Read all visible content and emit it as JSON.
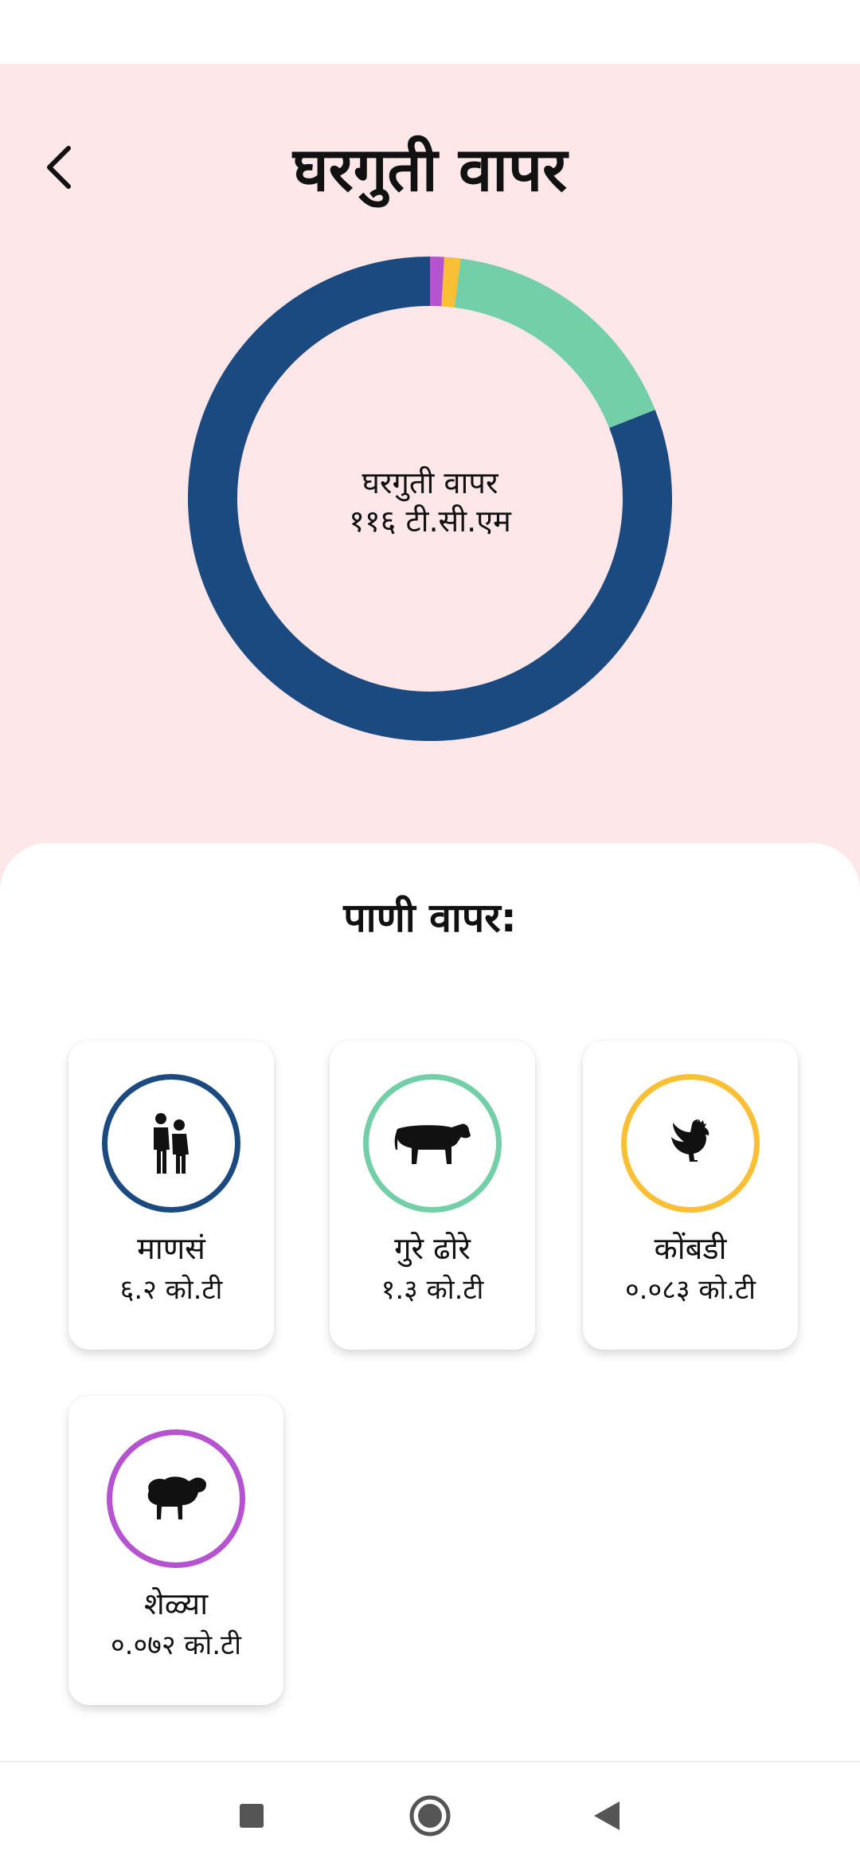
{
  "header": {
    "title": "घरगुती वापर"
  },
  "donut": {
    "center_label": "घरगुती वापर",
    "center_value": "११६ टी.सी.एम"
  },
  "chart_data": {
    "type": "pie",
    "categories": [
      "माणसं",
      "गुरे ढोरे",
      "कोंबडी",
      "शेळ्या"
    ],
    "values": [
      6.2,
      1.3,
      0.083,
      0.072
    ],
    "colors": [
      "#1a4a80",
      "#72cfa8",
      "#fbbf36",
      "#b653d0"
    ],
    "title": "",
    "legend": "none"
  },
  "section": {
    "title": "पाणी वापर:"
  },
  "cards": [
    {
      "label": "माणसं",
      "value": "६.२ को.टी",
      "icon": "people-icon",
      "color": "#1a4a80"
    },
    {
      "label": "गुरे ढोरे",
      "value": "१.३ को.टी",
      "icon": "cow-icon",
      "color": "#72cfa8"
    },
    {
      "label": "कोंबडी",
      "value": "०.०८३ को.टी",
      "icon": "rooster-icon",
      "color": "#fbbf36"
    },
    {
      "label": "शेळ्या",
      "value": "०.०७२ को.टी",
      "icon": "sheep-icon",
      "color": "#b653d0"
    }
  ],
  "nav": {
    "icons": [
      "recents-square-icon",
      "home-circle-icon",
      "back-triangle-icon"
    ]
  }
}
